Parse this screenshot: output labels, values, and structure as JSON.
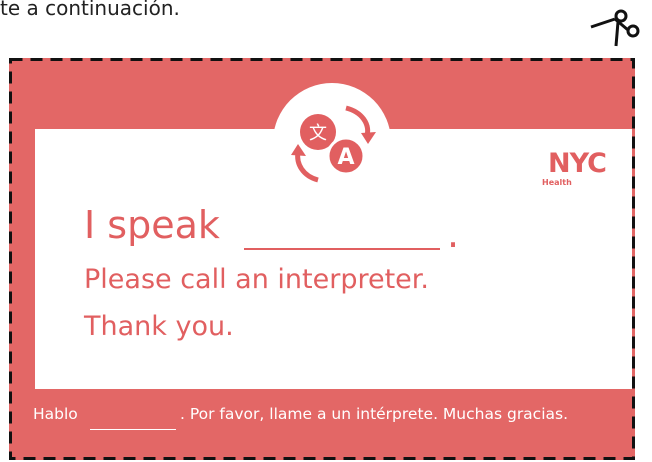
{
  "header": {
    "text": "te a continuación."
  },
  "card": {
    "speak_label": "I speak",
    "speak_period": ".",
    "line_please": "Please call an interpreter.",
    "line_thanks": "Thank you.",
    "logo_main": "NYC",
    "logo_sub": "Health",
    "translate_glyph": "文",
    "translate_letter": "A"
  },
  "footer": {
    "hablo": "Hablo",
    "rest": ". Por favor, llame a un intérprete. Muchas gracias."
  },
  "colors": {
    "card": "#e36766",
    "accent": "#e15f60",
    "text_dark": "#222222"
  },
  "icons": [
    "scissors-icon",
    "translate-icon"
  ]
}
